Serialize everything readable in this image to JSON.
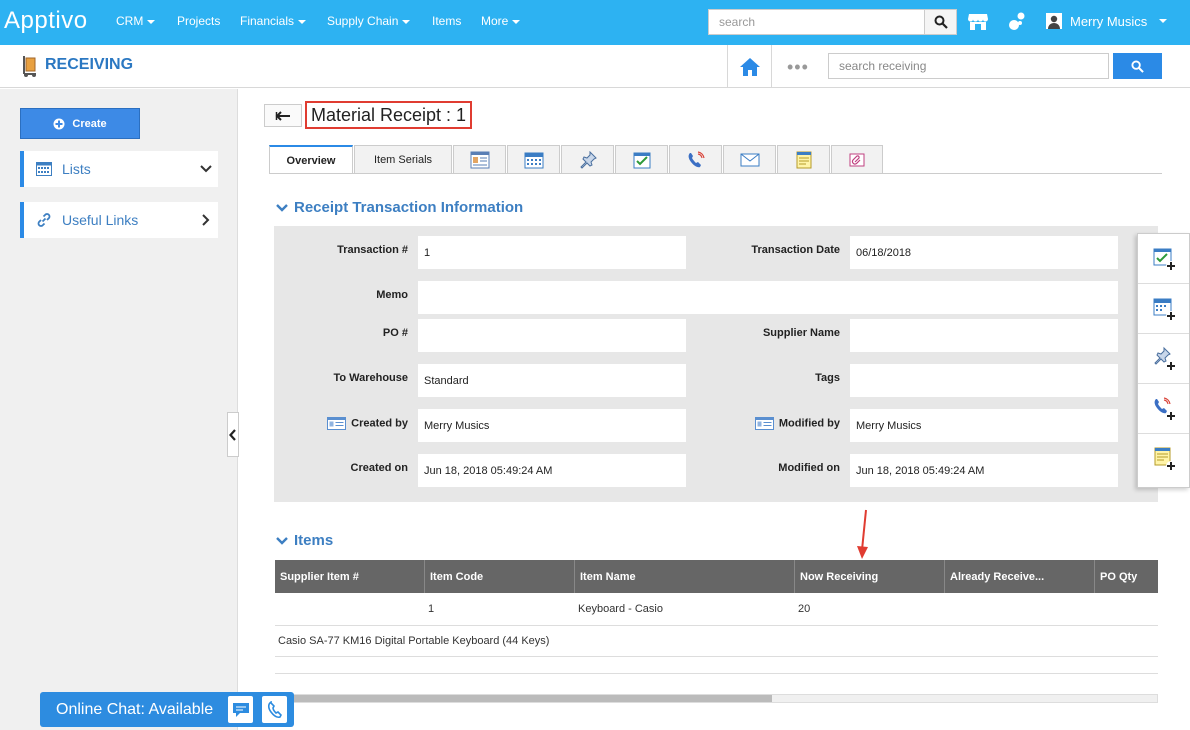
{
  "topbar": {
    "logo": "Apptivo",
    "nav": [
      "CRM",
      "Projects",
      "Financials",
      "Supply Chain",
      "Items",
      "More"
    ],
    "search_placeholder": "search",
    "user_name": "Merry Musics"
  },
  "module": {
    "title": "RECEIVING",
    "search_placeholder": "search receiving",
    "more_dots": "•••"
  },
  "sidebar": {
    "create_label": "Create",
    "lists_label": "Lists",
    "links_label": "Useful Links"
  },
  "record": {
    "title": "Material Receipt : 1",
    "tabs": [
      "Overview",
      "Item Serials"
    ]
  },
  "receipt_section": {
    "title": "Receipt Transaction Information",
    "transaction_no_label": "Transaction #",
    "transaction_no": "1",
    "transaction_date_label": "Transaction Date",
    "transaction_date": "06/18/2018",
    "memo_label": "Memo",
    "memo": "",
    "po_label": "PO #",
    "po": "",
    "supplier_label": "Supplier Name",
    "supplier": "",
    "warehouse_label": "To Warehouse",
    "warehouse": "Standard",
    "tags_label": "Tags",
    "tags": "",
    "created_by_label": "Created by",
    "created_by": "Merry Musics",
    "modified_by_label": "Modified by",
    "modified_by": "Merry Musics",
    "created_on_label": "Created on",
    "created_on": "Jun 18, 2018 05:49:24 AM",
    "modified_on_label": "Modified on",
    "modified_on": "Jun 18, 2018 05:49:24 AM"
  },
  "items_section": {
    "title": "Items",
    "columns": [
      "Supplier Item #",
      "Item Code",
      "Item Name",
      "Now Receiving",
      "Already Receive...",
      "PO Qty"
    ],
    "row": {
      "supplier_item": "",
      "item_code": "1",
      "item_name": "Keyboard - Casio",
      "now_receiving": "20",
      "already_received": "",
      "po_qty": ""
    },
    "description": "Casio SA-77 KM16 Digital Portable Keyboard (44 Keys)"
  },
  "chat": {
    "label": "Online Chat: Available"
  },
  "colors": {
    "topbar": "#2db2f2",
    "accent": "#2b8ae6",
    "highlight": "#e03c31"
  }
}
